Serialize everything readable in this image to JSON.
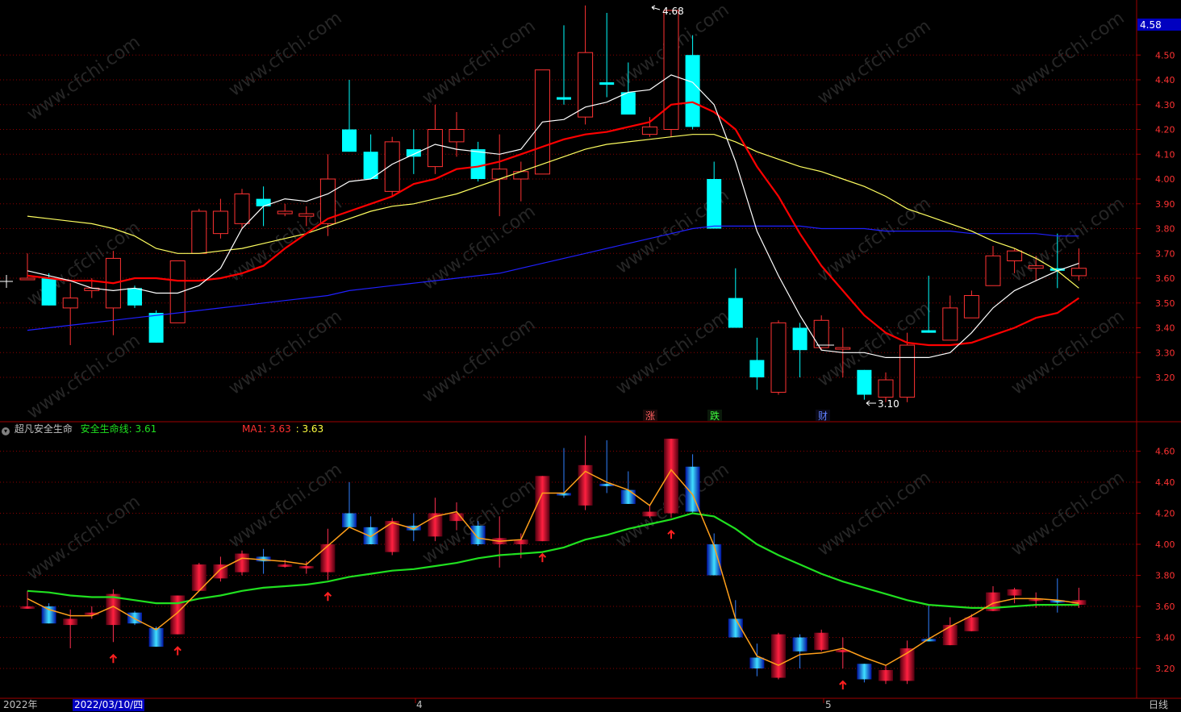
{
  "colors": {
    "up": "#ff3232",
    "down": "#00ffff",
    "ma5": "#ffffff",
    "ma10": "#ff0000",
    "ma20": "#ffff60",
    "ma60": "#2020ff",
    "safe": "#20e020",
    "ind_ma": "#ff9f1a",
    "grid": "#8b0000",
    "axis": "#a00000",
    "price_label": "#ff3232",
    "highlight": "#0000c0",
    "arrow": "#ff2020"
  },
  "top_axis": {
    "ticks": [
      "3.20",
      "3.30",
      "3.40",
      "3.50",
      "3.60",
      "3.70",
      "3.80",
      "3.90",
      "4.00",
      "4.10",
      "4.20",
      "4.30",
      "4.40",
      "4.50"
    ],
    "current": "4.58"
  },
  "bottom_axis": {
    "ticks": [
      "3.20",
      "3.40",
      "3.60",
      "3.80",
      "4.00",
      "4.20",
      "4.40",
      "4.60"
    ]
  },
  "markers": {
    "high": "4.68",
    "low": "3.10",
    "tags": [
      "涨",
      "跌",
      "财"
    ]
  },
  "indicator": {
    "name": "超凡安全生命",
    "line_label": "安全生命线: 3.61",
    "ma_label": "MA1: 3.63",
    "ma_value": ": 3.63"
  },
  "time_axis": {
    "year": "2022年",
    "cursor_date": "2022/03/10/四",
    "month_4": "4",
    "month_5": "5",
    "period": "日线"
  },
  "watermark": "www.cfchi.com",
  "chart_data": {
    "type": "candlestick",
    "period": "日线",
    "ylim": [
      3.1,
      4.7
    ],
    "candles": [
      [
        3.6,
        3.6,
        3.7,
        3.6
      ],
      [
        3.6,
        3.49,
        3.62,
        3.49
      ],
      [
        3.48,
        3.52,
        3.58,
        3.33
      ],
      [
        3.55,
        3.56,
        3.6,
        3.52
      ],
      [
        3.48,
        3.68,
        3.71,
        3.37
      ],
      [
        3.56,
        3.49,
        3.57,
        3.48
      ],
      [
        3.46,
        3.34,
        3.47,
        3.34
      ],
      [
        3.42,
        3.67,
        3.67,
        3.42
      ],
      [
        3.7,
        3.87,
        3.88,
        3.7
      ],
      [
        3.78,
        3.87,
        3.92,
        3.76
      ],
      [
        3.82,
        3.94,
        3.96,
        3.8
      ],
      [
        3.92,
        3.89,
        3.97,
        3.81
      ],
      [
        3.86,
        3.87,
        3.9,
        3.85
      ],
      [
        3.85,
        3.86,
        3.89,
        3.81
      ],
      [
        3.82,
        4.0,
        4.1,
        3.77
      ],
      [
        4.2,
        4.11,
        4.4,
        4.11
      ],
      [
        4.11,
        4.0,
        4.18,
        4.0
      ],
      [
        3.95,
        4.15,
        4.17,
        3.93
      ],
      [
        4.12,
        4.09,
        4.2,
        4.02
      ],
      [
        4.05,
        4.2,
        4.3,
        4.02
      ],
      [
        4.15,
        4.2,
        4.27,
        4.09
      ],
      [
        4.12,
        4.0,
        4.15,
        3.99
      ],
      [
        4.0,
        4.04,
        4.18,
        3.85
      ],
      [
        4.0,
        4.03,
        4.07,
        3.91
      ],
      [
        4.02,
        4.44,
        4.44,
        4.02
      ],
      [
        4.33,
        4.32,
        4.62,
        4.3
      ],
      [
        4.25,
        4.51,
        4.7,
        4.22
      ],
      [
        4.39,
        4.38,
        4.67,
        4.33
      ],
      [
        4.35,
        4.26,
        4.47,
        4.26
      ],
      [
        4.18,
        4.21,
        4.25,
        4.17
      ],
      [
        4.2,
        4.68,
        4.68,
        4.17
      ],
      [
        4.5,
        4.21,
        4.58,
        4.2
      ],
      [
        4.0,
        3.8,
        4.07,
        3.8
      ],
      [
        3.52,
        3.4,
        3.64,
        3.4
      ],
      [
        3.27,
        3.2,
        3.36,
        3.15
      ],
      [
        3.14,
        3.42,
        3.43,
        3.13
      ],
      [
        3.4,
        3.31,
        3.42,
        3.2
      ],
      [
        3.32,
        3.43,
        3.45,
        3.31
      ],
      [
        3.32,
        3.32,
        3.4,
        3.2
      ],
      [
        3.23,
        3.13,
        3.23,
        3.11
      ],
      [
        3.12,
        3.19,
        3.22,
        3.1
      ],
      [
        3.12,
        3.33,
        3.38,
        3.1
      ],
      [
        3.39,
        3.38,
        3.61,
        3.38
      ],
      [
        3.35,
        3.48,
        3.53,
        3.35
      ],
      [
        3.44,
        3.53,
        3.55,
        3.44
      ],
      [
        3.57,
        3.69,
        3.73,
        3.57
      ],
      [
        3.67,
        3.71,
        3.72,
        3.62
      ],
      [
        3.64,
        3.65,
        3.69,
        3.59
      ],
      [
        3.64,
        3.63,
        3.78,
        3.56
      ],
      [
        3.61,
        3.64,
        3.72,
        3.59
      ]
    ],
    "ma5": [
      3.63,
      3.61,
      3.59,
      3.56,
      3.55,
      3.56,
      3.54,
      3.54,
      3.57,
      3.64,
      3.8,
      3.89,
      3.92,
      3.91,
      3.94,
      3.99,
      4.0,
      4.06,
      4.1,
      4.14,
      4.12,
      4.11,
      4.1,
      4.12,
      4.23,
      4.24,
      4.29,
      4.31,
      4.35,
      4.36,
      4.42,
      4.39,
      4.3,
      4.07,
      3.79,
      3.61,
      3.45,
      3.31,
      3.3,
      3.3,
      3.28,
      3.28,
      3.28,
      3.3,
      3.38,
      3.48,
      3.55,
      3.59,
      3.63,
      3.66
    ],
    "ma10": [
      3.61,
      3.6,
      3.59,
      3.59,
      3.58,
      3.6,
      3.6,
      3.59,
      3.59,
      3.6,
      3.62,
      3.65,
      3.72,
      3.78,
      3.84,
      3.87,
      3.9,
      3.93,
      3.98,
      4.0,
      4.04,
      4.05,
      4.07,
      4.1,
      4.13,
      4.16,
      4.18,
      4.19,
      4.21,
      4.23,
      4.3,
      4.31,
      4.27,
      4.2,
      4.05,
      3.93,
      3.78,
      3.65,
      3.55,
      3.45,
      3.38,
      3.34,
      3.33,
      3.33,
      3.34,
      3.37,
      3.4,
      3.44,
      3.46,
      3.52
    ],
    "ma20": [
      3.85,
      3.84,
      3.83,
      3.82,
      3.8,
      3.77,
      3.72,
      3.7,
      3.7,
      3.71,
      3.72,
      3.74,
      3.76,
      3.78,
      3.81,
      3.84,
      3.87,
      3.89,
      3.9,
      3.92,
      3.94,
      3.97,
      4.0,
      4.03,
      4.06,
      4.09,
      4.12,
      4.14,
      4.15,
      4.16,
      4.17,
      4.18,
      4.18,
      4.15,
      4.11,
      4.08,
      4.05,
      4.03,
      4.0,
      3.97,
      3.93,
      3.88,
      3.85,
      3.82,
      3.79,
      3.75,
      3.72,
      3.68,
      3.63,
      3.56
    ],
    "ma60": [
      3.39,
      3.4,
      3.41,
      3.42,
      3.43,
      3.44,
      3.45,
      3.46,
      3.47,
      3.48,
      3.49,
      3.5,
      3.51,
      3.52,
      3.53,
      3.55,
      3.56,
      3.57,
      3.58,
      3.59,
      3.6,
      3.61,
      3.62,
      3.64,
      3.66,
      3.68,
      3.7,
      3.72,
      3.74,
      3.76,
      3.78,
      3.8,
      3.81,
      3.81,
      3.81,
      3.81,
      3.81,
      3.8,
      3.8,
      3.8,
      3.79,
      3.79,
      3.79,
      3.79,
      3.78,
      3.78,
      3.78,
      3.78,
      3.77,
      3.77
    ],
    "safe_line": [
      3.7,
      3.69,
      3.67,
      3.66,
      3.66,
      3.64,
      3.62,
      3.62,
      3.65,
      3.67,
      3.7,
      3.72,
      3.73,
      3.74,
      3.76,
      3.79,
      3.81,
      3.83,
      3.84,
      3.86,
      3.88,
      3.91,
      3.93,
      3.94,
      3.95,
      3.98,
      4.03,
      4.06,
      4.1,
      4.13,
      4.16,
      4.2,
      4.18,
      4.1,
      4.0,
      3.93,
      3.87,
      3.81,
      3.76,
      3.72,
      3.68,
      3.64,
      3.61,
      3.6,
      3.59,
      3.59,
      3.6,
      3.61,
      3.61,
      3.61
    ],
    "ind_ma": [
      3.65,
      3.58,
      3.54,
      3.54,
      3.6,
      3.52,
      3.45,
      3.56,
      3.7,
      3.84,
      3.91,
      3.9,
      3.89,
      3.87,
      3.99,
      4.11,
      4.05,
      4.14,
      4.1,
      4.18,
      4.21,
      4.04,
      4.02,
      4.03,
      4.33,
      4.33,
      4.47,
      4.4,
      4.35,
      4.25,
      4.48,
      4.32,
      3.99,
      3.52,
      3.28,
      3.22,
      3.29,
      3.3,
      3.33,
      3.27,
      3.22,
      3.3,
      3.39,
      3.47,
      3.54,
      3.62,
      3.65,
      3.65,
      3.64,
      3.62
    ],
    "signal_arrows": [
      4,
      7,
      14,
      24,
      30,
      38
    ]
  }
}
